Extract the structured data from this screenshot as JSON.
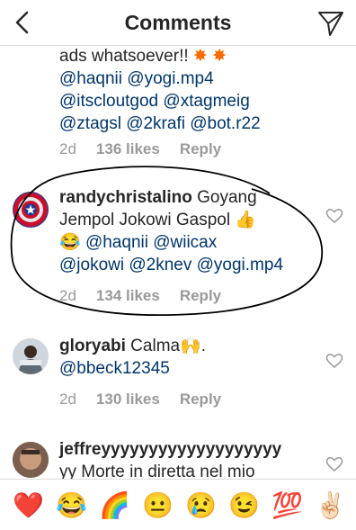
{
  "header": {
    "title": "Comments"
  },
  "comments": [
    {
      "lines": [
        {
          "parts": [
            {
              "t": "ads whatsoever!! ",
              "m": false
            }
          ]
        },
        {
          "parts": [
            {
              "t": "@haqnii @yogi.mp4",
              "m": true
            }
          ]
        },
        {
          "parts": [
            {
              "t": "@itscloutgod @xtagmeig",
              "m": true
            }
          ]
        },
        {
          "parts": [
            {
              "t": "@ztagsl @2krafi @bot.r22",
              "m": true
            }
          ]
        }
      ],
      "age": "2d",
      "likes": "136 likes",
      "reply": "Reply"
    },
    {
      "username": "randychristalino",
      "line1": " Goyang",
      "line2": "Jempol Jokowi Gaspol ",
      "line3": "@haqnii @wiicax",
      "line4": "@jokowi @2knev @yogi.mp4",
      "age": "2d",
      "likes": "134 likes",
      "reply": "Reply"
    },
    {
      "username": "gloryabi",
      "line1": " Calma",
      "line1_end": ".",
      "line2": "@bbeck12345",
      "age": "2d",
      "likes": "130 likes",
      "reply": "Reply"
    },
    {
      "username": "jeffreyyyyyyyyyyyyyyyyyyy",
      "line2": "yy Morte in diretta nel mio"
    }
  ],
  "emoji_bar": [
    "red-heart",
    "face-with-tears-of-joy",
    "rainbow",
    "neutral-face",
    "crying-face",
    "winking-face",
    "hundred-points",
    "victory-hand"
  ],
  "colors": {
    "mention": "#003569",
    "meta": "#999999",
    "text": "#262626"
  }
}
